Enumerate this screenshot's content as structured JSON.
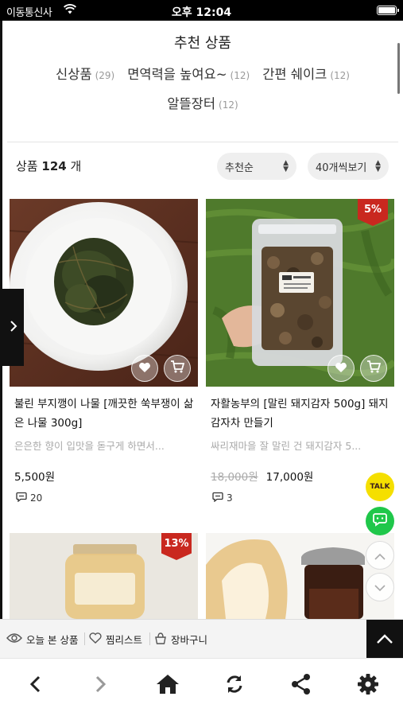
{
  "status": {
    "carrier": "이동통신사",
    "time": "오후 12:04"
  },
  "section": {
    "title": "추천 상품"
  },
  "categories": [
    {
      "label": "신상품",
      "count": "(29)"
    },
    {
      "label": "면역력을 높여요~",
      "count": "(12)"
    },
    {
      "label": "간편 쉐이크",
      "count": "(12)"
    },
    {
      "label": "알뜰장터",
      "count": "(12)"
    }
  ],
  "listing": {
    "count_prefix": "상품",
    "count_value": "124",
    "count_suffix": "개",
    "sort_label": "추천순",
    "per_page_label": "40개씩보기"
  },
  "products": [
    {
      "title": "불린 부지깽이 나물 [깨끗한 쑥부쟁이 삶은 나물 300g]",
      "desc": "은은한 향이 입맛을 돋구게 하면서...",
      "price": "5,500원",
      "old_price": "",
      "reviews": "20",
      "badge": ""
    },
    {
      "title": "자활농부의 [말린 돼지감자 500g] 돼지감자차 만들기",
      "desc": "싸리재마을 잘 말린 건 돼지감자 5...",
      "price": "17,000원",
      "old_price": "18,000원",
      "reviews": "3",
      "badge": "5%"
    },
    {
      "badge": "13%"
    },
    {
      "badge": ""
    }
  ],
  "floating": {
    "talk": "TALK"
  },
  "bottom_strip": {
    "recent": "오늘 본 상품",
    "wishlist": "찜리스트",
    "cart": "장바구니"
  },
  "colors": {
    "badge": "#c9281f",
    "talk": "#f5df00",
    "chat": "#1fc74a"
  }
}
